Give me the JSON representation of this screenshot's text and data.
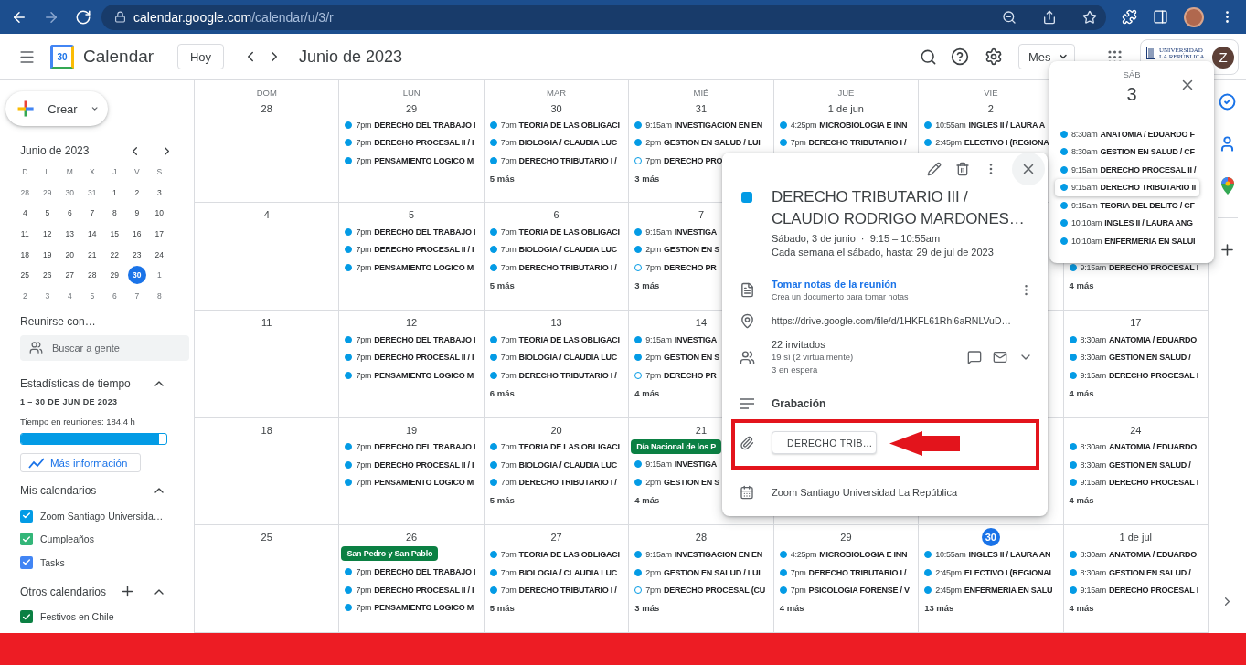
{
  "browser": {
    "url_host": "calendar.google.com",
    "url_path": "/calendar/u/3/r"
  },
  "header": {
    "logo_text": "30",
    "app_name": "Calendar",
    "today_button": "Hoy",
    "title": "Junio de 2023",
    "view": "Mes",
    "org_name": "UNIVERSIDAD LA REPÚBLICA",
    "avatar": "Z"
  },
  "sidebar": {
    "create": "Crear",
    "mini_calendar": {
      "title": "Junio de 2023",
      "weekdays": [
        "D",
        "L",
        "M",
        "X",
        "J",
        "V",
        "S"
      ],
      "weeks": [
        [
          {
            "d": "28",
            "outside": true,
            "selected": false
          },
          {
            "d": "29",
            "outside": true,
            "selected": false
          },
          {
            "d": "30",
            "outside": true,
            "selected": false
          },
          {
            "d": "31",
            "outside": true,
            "selected": false
          },
          {
            "d": "1",
            "outside": false,
            "selected": false
          },
          {
            "d": "2",
            "outside": false,
            "selected": false
          },
          {
            "d": "3",
            "outside": false,
            "selected": false
          }
        ],
        [
          {
            "d": "4",
            "outside": false,
            "selected": false
          },
          {
            "d": "5",
            "outside": false,
            "selected": false
          },
          {
            "d": "6",
            "outside": false,
            "selected": false
          },
          {
            "d": "7",
            "outside": false,
            "selected": false
          },
          {
            "d": "8",
            "outside": false,
            "selected": false
          },
          {
            "d": "9",
            "outside": false,
            "selected": false
          },
          {
            "d": "10",
            "outside": false,
            "selected": false
          }
        ],
        [
          {
            "d": "11",
            "outside": false,
            "selected": false
          },
          {
            "d": "12",
            "outside": false,
            "selected": false
          },
          {
            "d": "13",
            "outside": false,
            "selected": false
          },
          {
            "d": "14",
            "outside": false,
            "selected": false
          },
          {
            "d": "15",
            "outside": false,
            "selected": false
          },
          {
            "d": "16",
            "outside": false,
            "selected": false
          },
          {
            "d": "17",
            "outside": false,
            "selected": false
          }
        ],
        [
          {
            "d": "18",
            "outside": false,
            "selected": false
          },
          {
            "d": "19",
            "outside": false,
            "selected": false
          },
          {
            "d": "20",
            "outside": false,
            "selected": false
          },
          {
            "d": "21",
            "outside": false,
            "selected": false
          },
          {
            "d": "22",
            "outside": false,
            "selected": false
          },
          {
            "d": "23",
            "outside": false,
            "selected": false
          },
          {
            "d": "24",
            "outside": false,
            "selected": false
          }
        ],
        [
          {
            "d": "25",
            "outside": false,
            "selected": false
          },
          {
            "d": "26",
            "outside": false,
            "selected": false
          },
          {
            "d": "27",
            "outside": false,
            "selected": false
          },
          {
            "d": "28",
            "outside": false,
            "selected": false
          },
          {
            "d": "29",
            "outside": false,
            "selected": false
          },
          {
            "d": "30",
            "outside": false,
            "selected": true
          },
          {
            "d": "1",
            "outside": true,
            "selected": false
          }
        ],
        [
          {
            "d": "2",
            "outside": true,
            "selected": false
          },
          {
            "d": "3",
            "outside": true,
            "selected": false
          },
          {
            "d": "4",
            "outside": true,
            "selected": false
          },
          {
            "d": "5",
            "outside": true,
            "selected": false
          },
          {
            "d": "6",
            "outside": true,
            "selected": false
          },
          {
            "d": "7",
            "outside": true,
            "selected": false
          },
          {
            "d": "8",
            "outside": true,
            "selected": false
          }
        ]
      ]
    },
    "meet": {
      "title": "Reunirse con…",
      "placeholder": "Buscar a gente"
    },
    "stats": {
      "title": "Estadísticas de tiempo",
      "expanded": true,
      "range": "1 – 30 DE JUN DE 2023",
      "label": "Tiempo en reuniones: 184.4 h",
      "level": 0.95,
      "button": "Más información"
    },
    "my_calendars": {
      "title": "Mis calendarios",
      "expanded": true,
      "items": [
        {
          "name": "Zoom Santiago Universida…",
          "checked": true,
          "color": "#039be5"
        },
        {
          "name": "Cumpleaños",
          "checked": true,
          "color": "#33b679"
        },
        {
          "name": "Tasks",
          "checked": true,
          "color": "#4285f4"
        }
      ]
    },
    "other_calendars": {
      "title": "Otros calendarios",
      "expanded": true,
      "items": [
        {
          "name": "Festivos en Chile",
          "checked": true,
          "color": "#0b8043"
        }
      ]
    }
  },
  "grid": {
    "weekdays": [
      "DOM",
      "LUN",
      "MAR",
      "MIÉ",
      "JUE",
      "VIE"
    ],
    "weeks": [
      {
        "cells": [
          {
            "date": "28",
            "today": false
          },
          {
            "date": "29",
            "today": false,
            "events": [
              {
                "time": "7pm",
                "title": "DERECHO DEL TRABAJO I",
                "outline": false
              },
              {
                "time": "7pm",
                "title": "DERECHO PROCESAL II / I",
                "outline": false
              },
              {
                "time": "7pm",
                "title": "PENSAMIENTO LOGICO M",
                "outline": false
              }
            ]
          },
          {
            "date": "30",
            "today": false,
            "events": [
              {
                "time": "7pm",
                "title": "TEORIA DE LAS OBLIGACI",
                "outline": false
              },
              {
                "time": "7pm",
                "title": "BIOLOGIA / CLAUDIA LUC",
                "outline": false
              },
              {
                "time": "7pm",
                "title": "DERECHO TRIBUTARIO I /",
                "outline": false
              }
            ],
            "more": "5 más"
          },
          {
            "date": "31",
            "today": false,
            "events": [
              {
                "time": "9:15am",
                "title": "INVESTIGACION EN EN",
                "outline": false
              },
              {
                "time": "2pm",
                "title": "GESTION EN SALUD / LUI",
                "outline": false
              },
              {
                "time": "7pm",
                "title": "DERECHO PRO",
                "outline": true
              }
            ],
            "more": "3 más"
          },
          {
            "date": "1 de jun",
            "today": false,
            "events": [
              {
                "time": "4:25pm",
                "title": "MICROBIOLOGIA E INN",
                "outline": false
              },
              {
                "time": "7pm",
                "title": "DERECHO TRIBUTARIO I /",
                "outline": false
              }
            ]
          },
          {
            "date": "2",
            "today": false,
            "events": [
              {
                "time": "10:55am",
                "title": "INGLES II / LAURA A",
                "outline": false
              },
              {
                "time": "2:45pm",
                "title": "ELECTIVO I (REGIONA",
                "outline": false
              }
            ]
          },
          {}
        ]
      },
      {
        "cells": [
          {
            "date": "4",
            "today": false
          },
          {
            "date": "5",
            "today": false,
            "events": [
              {
                "time": "7pm",
                "title": "DERECHO DEL TRABAJO I",
                "outline": false
              },
              {
                "time": "7pm",
                "title": "DERECHO PROCESAL II / I",
                "outline": false
              },
              {
                "time": "7pm",
                "title": "PENSAMIENTO LOGICO M",
                "outline": false
              }
            ]
          },
          {
            "date": "6",
            "today": false,
            "events": [
              {
                "time": "7pm",
                "title": "TEORIA DE LAS OBLIGACI",
                "outline": false
              },
              {
                "time": "7pm",
                "title": "BIOLOGIA / CLAUDIA LUC",
                "outline": false
              },
              {
                "time": "7pm",
                "title": "DERECHO TRIBUTARIO I /",
                "outline": false
              }
            ],
            "more": "5 más"
          },
          {
            "date": "7",
            "today": false,
            "events": [
              {
                "time": "9:15am",
                "title": "INVESTIGA",
                "outline": false
              },
              {
                "time": "2pm",
                "title": "GESTION EN S",
                "outline": false
              },
              {
                "time": "7pm",
                "title": "DERECHO PR",
                "outline": true
              }
            ],
            "more": "3 más"
          },
          {},
          {},
          {
            "events": [
              {
                "time": "9:15am",
                "title": "DERECHO PROCESAL I",
                "outline": false
              }
            ],
            "more": "4 más"
          }
        ]
      },
      {
        "cells": [
          {
            "date": "11",
            "today": false
          },
          {
            "date": "12",
            "today": false,
            "events": [
              {
                "time": "7pm",
                "title": "DERECHO DEL TRABAJO I",
                "outline": false
              },
              {
                "time": "7pm",
                "title": "DERECHO PROCESAL II / I",
                "outline": false
              },
              {
                "time": "7pm",
                "title": "PENSAMIENTO LOGICO M",
                "outline": false
              }
            ]
          },
          {
            "date": "13",
            "today": false,
            "events": [
              {
                "time": "7pm",
                "title": "TEORIA DE LAS OBLIGACI",
                "outline": false
              },
              {
                "time": "7pm",
                "title": "BIOLOGIA / CLAUDIA LUC",
                "outline": false
              },
              {
                "time": "7pm",
                "title": "DERECHO TRIBUTARIO I /",
                "outline": false
              }
            ],
            "more": "6 más"
          },
          {
            "date": "14",
            "today": false,
            "events": [
              {
                "time": "9:15am",
                "title": "INVESTIGA",
                "outline": false
              },
              {
                "time": "2pm",
                "title": "GESTION EN S",
                "outline": false
              },
              {
                "time": "7pm",
                "title": "DERECHO PR",
                "outline": true
              }
            ],
            "more": "4 más"
          },
          {},
          {},
          {
            "date": "17",
            "today": false,
            "events": [
              {
                "time": "8:30am",
                "title": "ANATOMIA / EDUARDO",
                "outline": false
              },
              {
                "time": "8:30am",
                "title": "GESTION EN SALUD /",
                "outline": false
              },
              {
                "time": "9:15am",
                "title": "DERECHO PROCESAL I",
                "outline": false
              }
            ],
            "more": "4 más"
          }
        ]
      },
      {
        "cells": [
          {
            "date": "18",
            "today": false
          },
          {
            "date": "19",
            "today": false,
            "events": [
              {
                "time": "7pm",
                "title": "DERECHO DEL TRABAJO I",
                "outline": false
              },
              {
                "time": "7pm",
                "title": "DERECHO PROCESAL II / I",
                "outline": false
              },
              {
                "time": "7pm",
                "title": "PENSAMIENTO LOGICO M",
                "outline": false
              }
            ]
          },
          {
            "date": "20",
            "today": false,
            "events": [
              {
                "time": "7pm",
                "title": "TEORIA DE LAS OBLIGACI",
                "outline": false
              },
              {
                "time": "7pm",
                "title": "BIOLOGIA / CLAUDIA LUC",
                "outline": false
              },
              {
                "time": "7pm",
                "title": "DERECHO TRIBUTARIO I /",
                "outline": false
              }
            ],
            "more": "5 más"
          },
          {
            "date": "21",
            "today": false,
            "allday": {
              "title": "Día Nacional de los P",
              "color": "#0b8043"
            },
            "events": [
              {
                "time": "9:15am",
                "title": "INVESTIGA",
                "outline": false
              },
              {
                "time": "2pm",
                "title": "GESTION EN S",
                "outline": false
              }
            ],
            "more": "4 más"
          },
          {},
          {},
          {
            "date": "24",
            "today": false,
            "events": [
              {
                "time": "8:30am",
                "title": "ANATOMIA / EDUARDO",
                "outline": false
              },
              {
                "time": "8:30am",
                "title": "GESTION EN SALUD /",
                "outline": false
              },
              {
                "time": "9:15am",
                "title": "DERECHO PROCESAL I",
                "outline": false
              }
            ],
            "more": "4 más"
          }
        ]
      },
      {
        "cells": [
          {
            "date": "25",
            "today": false
          },
          {
            "date": "26",
            "today": false,
            "allday": {
              "title": "San Pedro y San Pablo",
              "color": "#0b8043"
            },
            "events": [
              {
                "time": "7pm",
                "title": "DERECHO DEL TRABAJO I",
                "outline": false
              },
              {
                "time": "7pm",
                "title": "DERECHO PROCESAL II / I",
                "outline": false
              },
              {
                "time": "7pm",
                "title": "PENSAMIENTO LOGICO M",
                "outline": false
              }
            ]
          },
          {
            "date": "27",
            "today": false,
            "events": [
              {
                "time": "7pm",
                "title": "TEORIA DE LAS OBLIGACI",
                "outline": false
              },
              {
                "time": "7pm",
                "title": "BIOLOGIA / CLAUDIA LUC",
                "outline": false
              },
              {
                "time": "7pm",
                "title": "DERECHO TRIBUTARIO I /",
                "outline": false
              }
            ],
            "more": "5 más"
          },
          {
            "date": "28",
            "today": false,
            "events": [
              {
                "time": "9:15am",
                "title": "INVESTIGACION EN EN",
                "outline": false
              },
              {
                "time": "2pm",
                "title": "GESTION EN SALUD / LUI",
                "outline": false
              },
              {
                "time": "7pm",
                "title": "DERECHO PROCESAL (CU",
                "outline": true
              }
            ],
            "more": "3 más"
          },
          {
            "date": "29",
            "today": false,
            "events": [
              {
                "time": "4:25pm",
                "title": "MICROBIOLOGIA E INN",
                "outline": false
              },
              {
                "time": "7pm",
                "title": "DERECHO TRIBUTARIO I /",
                "outline": false
              },
              {
                "time": "7pm",
                "title": "PSICOLOGIA FORENSE / V",
                "outline": false
              }
            ],
            "more": "4 más"
          },
          {
            "date": "30",
            "today": true,
            "events": [
              {
                "time": "10:55am",
                "title": "INGLES II / LAURA AN",
                "outline": false
              },
              {
                "time": "2:45pm",
                "title": "ELECTIVO I (REGIONAI",
                "outline": false
              },
              {
                "time": "2:45pm",
                "title": "ENFERMERIA EN SALU",
                "outline": false
              }
            ],
            "more": "13 más"
          },
          {
            "date": "1 de jul",
            "today": false,
            "events": [
              {
                "time": "8:30am",
                "title": "ANATOMIA / EDUARDO",
                "outline": false
              },
              {
                "time": "8:30am",
                "title": "GESTION EN SALUD /",
                "outline": false
              },
              {
                "time": "9:15am",
                "title": "DERECHO PROCESAL I",
                "outline": false
              }
            ],
            "more": "4 más"
          }
        ]
      }
    ]
  },
  "day_popup": {
    "weekday": "SÁB",
    "date": "3",
    "events": [
      {
        "time": "8:30am",
        "title": "ANATOMIA / EDUARDO F",
        "selected": false
      },
      {
        "time": "8:30am",
        "title": "GESTION EN SALUD / CF",
        "selected": false
      },
      {
        "time": "9:15am",
        "title": "DERECHO PROCESAL II /",
        "selected": false
      },
      {
        "time": "9:15am",
        "title": "DERECHO TRIBUTARIO II",
        "selected": true
      },
      {
        "time": "9:15am",
        "title": "TEORIA DEL DELITO / CF",
        "selected": false
      },
      {
        "time": "10:10am",
        "title": "INGLES II / LAURA ANG",
        "selected": false
      },
      {
        "time": "10:10am",
        "title": "ENFERMERIA EN SALUI",
        "selected": false
      }
    ]
  },
  "event_popup": {
    "color": "#039be5",
    "title": "DERECHO TRIBUTARIO III / CLAUDIO RODRIGO MARDONES…",
    "when": "Sábado, 3 de junio  ·  9:15 – 10:55am",
    "recurrence": "Cada semana el sábado, hasta: 29 de jul de 2023",
    "notes_link": "Tomar notas de la reunión",
    "notes_hint": "Crea un documento para tomar notas",
    "location": "https://drive.google.com/file/d/1HKFL61Rhl6aRNLVuD…",
    "guests": "22 invitados",
    "guests_yes": "19 sí (2 virtualmente)",
    "guests_waiting": "3 en espera",
    "description": "Grabación",
    "attachment": "DERECHO TRIB…",
    "calendar": "Zoom Santiago Universidad La República"
  }
}
